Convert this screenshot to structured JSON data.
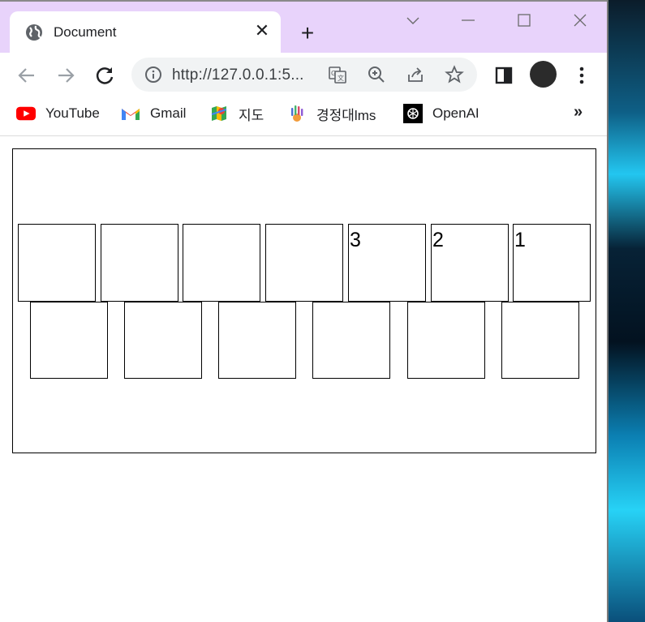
{
  "browser": {
    "tab": {
      "title": "Document",
      "close_icon": "close-icon",
      "favicon": "globe-icon"
    },
    "new_tab_icon": "plus-icon",
    "window_controls": [
      "chevron-down-icon",
      "minimize-icon",
      "maximize-icon",
      "close-icon"
    ],
    "address_bar": {
      "url": "http://127.0.0.1:5..."
    },
    "bookmarks": [
      {
        "label": "YouTube",
        "icon": "youtube-icon"
      },
      {
        "label": "Gmail",
        "icon": "gmail-icon"
      },
      {
        "label": "지도",
        "icon": "maps-icon"
      },
      {
        "label": "경정대lms",
        "icon": "lms-icon"
      },
      {
        "label": "OpenAI",
        "icon": "openai-icon"
      }
    ],
    "more_label": "»"
  },
  "page": {
    "top_row": [
      "",
      "",
      "",
      "",
      "3",
      "2",
      "1"
    ],
    "bottom_row": [
      "",
      "",
      "",
      "",
      "",
      ""
    ]
  }
}
